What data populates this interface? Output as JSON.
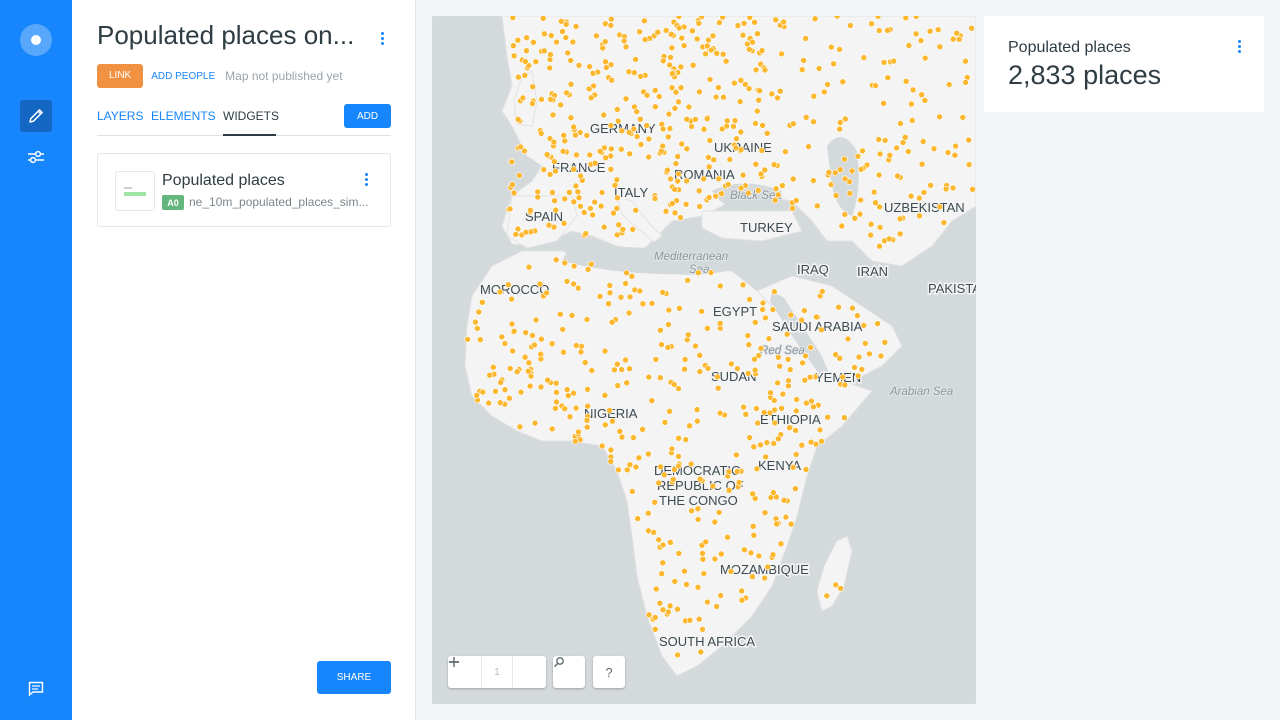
{
  "app": {
    "panel_title": "Populated places on...",
    "link_button": "LINK",
    "add_people": "ADD PEOPLE",
    "publish_status": "Map not published yet",
    "accent_color": "#1785fb",
    "link_color": "#f19243"
  },
  "tabs": [
    {
      "label": "LAYERS",
      "active": false
    },
    {
      "label": "ELEMENTS",
      "active": false
    },
    {
      "label": "WIDGETS",
      "active": true
    }
  ],
  "add_button": "ADD",
  "share_button": "SHARE",
  "widget_list": [
    {
      "title": "Populated places",
      "layer_badge": "A0",
      "layer_source": "ne_10m_populated_places_sim...",
      "badge_color": "#65b67e"
    }
  ],
  "map": {
    "zoom_level": "1",
    "zoom_out_icon": "minus-icon",
    "zoom_in_icon": "plus-icon",
    "search_icon": "search-icon",
    "help_label": "?",
    "point_color": "#fbb72e",
    "country_labels": [
      "GERMANY",
      "UKRAINE",
      "FRANCE",
      "ROMANIA",
      "ITALY",
      "SPAIN",
      "TURKEY",
      "UZBEKISTAN",
      "IRAQ",
      "IRAN",
      "MOROCCO",
      "PAKISTA",
      "EGYPT",
      "SAUDI ARABIA",
      "SUDAN",
      "YEMEN",
      "NIGERIA",
      "ETHIOPIA",
      "KENYA",
      "DEMOCRATIC",
      "REPUBLIC OF",
      "THE CONGO",
      "MOZAMBIQUE",
      "SOUTH AFRICA"
    ],
    "sea_labels": [
      "Black Sea",
      "Mediterranean",
      "Sea",
      "Red Sea",
      "Arabian Sea"
    ]
  },
  "widget_panel": {
    "title": "Populated places",
    "value": "2,833 places"
  }
}
